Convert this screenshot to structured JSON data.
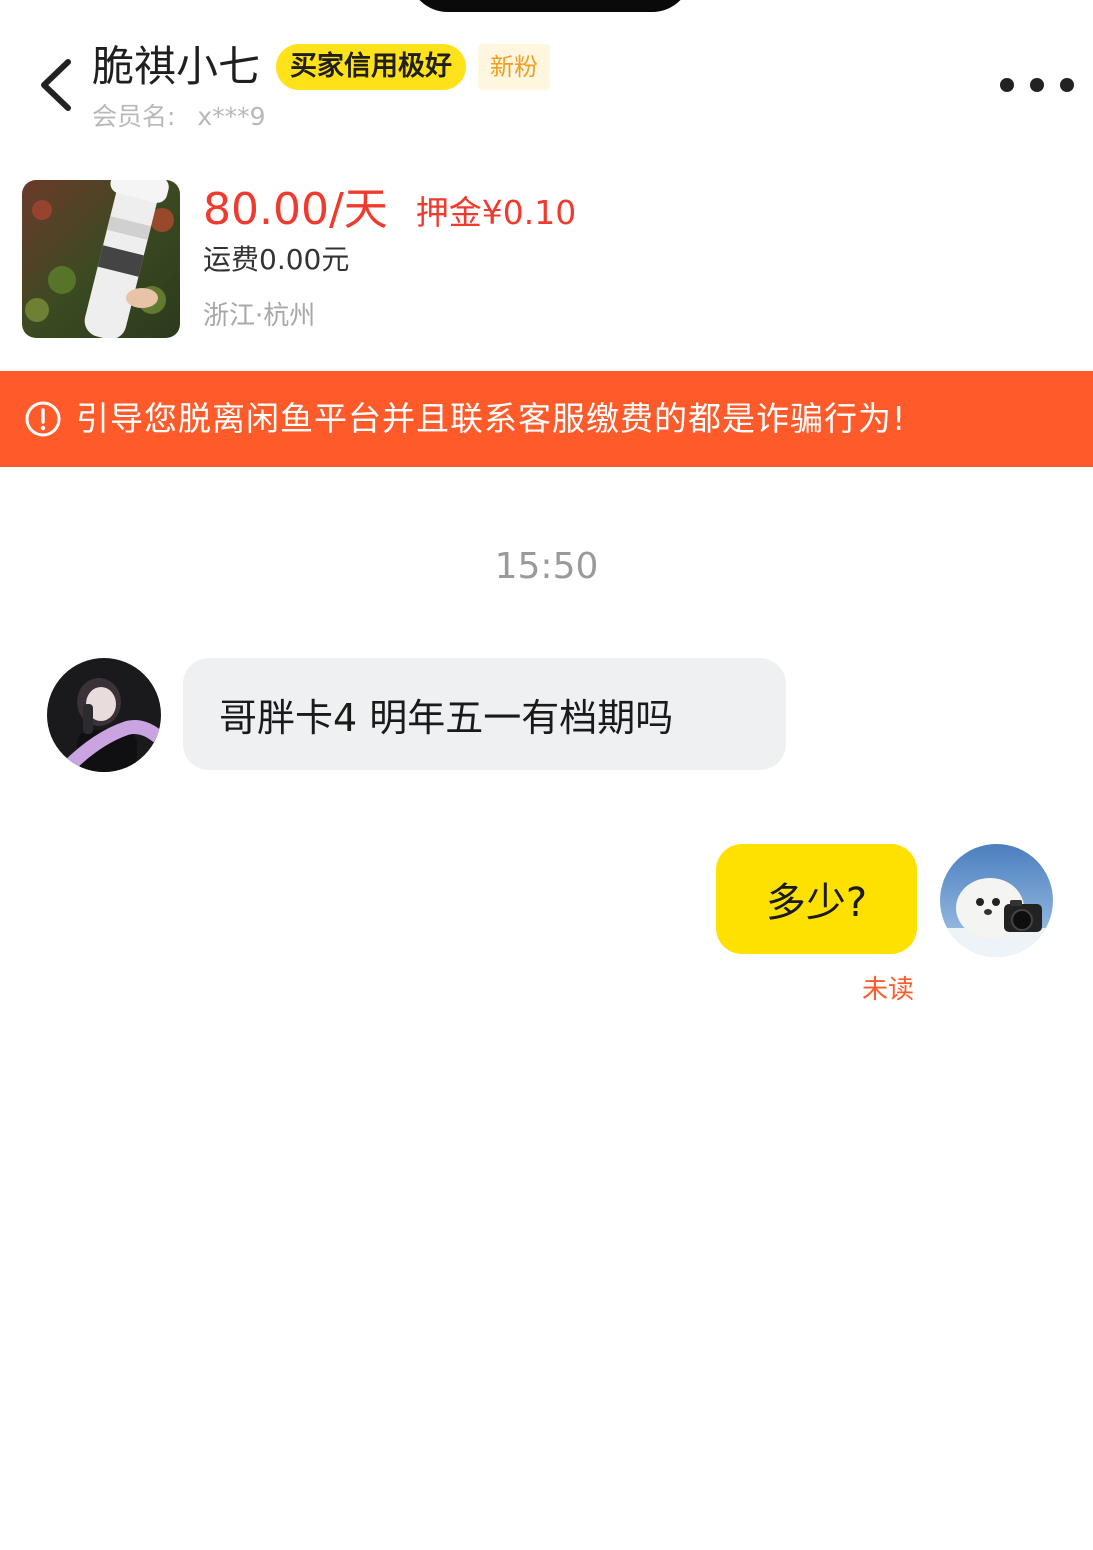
{
  "header": {
    "title": "脆祺小七",
    "credit_badge": "买家信用极好",
    "new_fan_badge": "新粉",
    "member_label": "会员名:",
    "member_value": "x***9",
    "back_icon": "chevron-left-icon",
    "more_icon": "more-dots-icon"
  },
  "product": {
    "price": "80.00/天",
    "deposit": "押金¥0.10",
    "shipping": "运费0.00元",
    "location": "浙江·杭州",
    "image": "telephoto-lens-photo"
  },
  "warning": {
    "icon": "exclamation-circle-icon",
    "text": "引导您脱离闲鱼平台并且联系客服缴费的都是诈骗行为!"
  },
  "chat": {
    "timestamp": "15:50",
    "messages": [
      {
        "side": "left",
        "text": "哥胖卡4 明年五一有档期吗",
        "avatar": "buyer-avatar"
      },
      {
        "side": "right",
        "text": "多少?",
        "avatar": "seal-with-camera-avatar",
        "status": "未读"
      }
    ]
  },
  "colors": {
    "price_red": "#f03a2e",
    "warning_orange": "#ff5a2a",
    "self_bubble_yellow": "#ffe100",
    "credit_badge_yellow": "#ffe21a",
    "other_bubble_gray": "#eef0f1"
  }
}
